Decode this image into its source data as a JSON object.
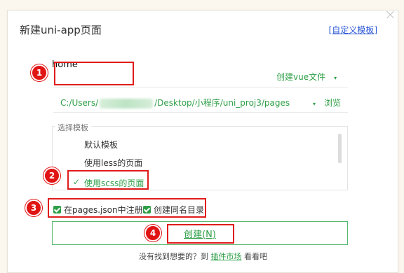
{
  "dialog": {
    "title": "新建uni-app页面",
    "template_link_label": "自定义模板",
    "template_link_brackets": [
      "[",
      "]"
    ]
  },
  "name_field": {
    "value": "home"
  },
  "file_type_select": {
    "label": "创建vue文件",
    "caret": "▾"
  },
  "path": {
    "prefix": "C:/Users/",
    "suffix": "/Desktop/小程序/uni_proj3/pages",
    "caret": "▾",
    "browse_label": "浏览"
  },
  "template_group": {
    "legend": "选择模板",
    "items": [
      {
        "label": "默认模板",
        "selected": false
      },
      {
        "label": "使用less的页面",
        "selected": false
      },
      {
        "label": "使用scss的页面",
        "selected": true
      }
    ],
    "check_glyph": "✓"
  },
  "options": {
    "register_pages_json": {
      "label": "在pages.json中注册",
      "checked": true
    },
    "create_same_name_dir": {
      "label": "创建同名目录",
      "checked": true
    }
  },
  "create_button": {
    "label": "创建(N)"
  },
  "footer": {
    "prefix": "没有找到想要的？到",
    "link": "插件市场",
    "suffix": "看看吧"
  },
  "annotations": {
    "badges": [
      "1",
      "2",
      "3",
      "4"
    ]
  },
  "colors": {
    "accent_green": "#2e9f47",
    "annotation_red": "#e01b1b",
    "link_blue": "#2a57d6"
  }
}
